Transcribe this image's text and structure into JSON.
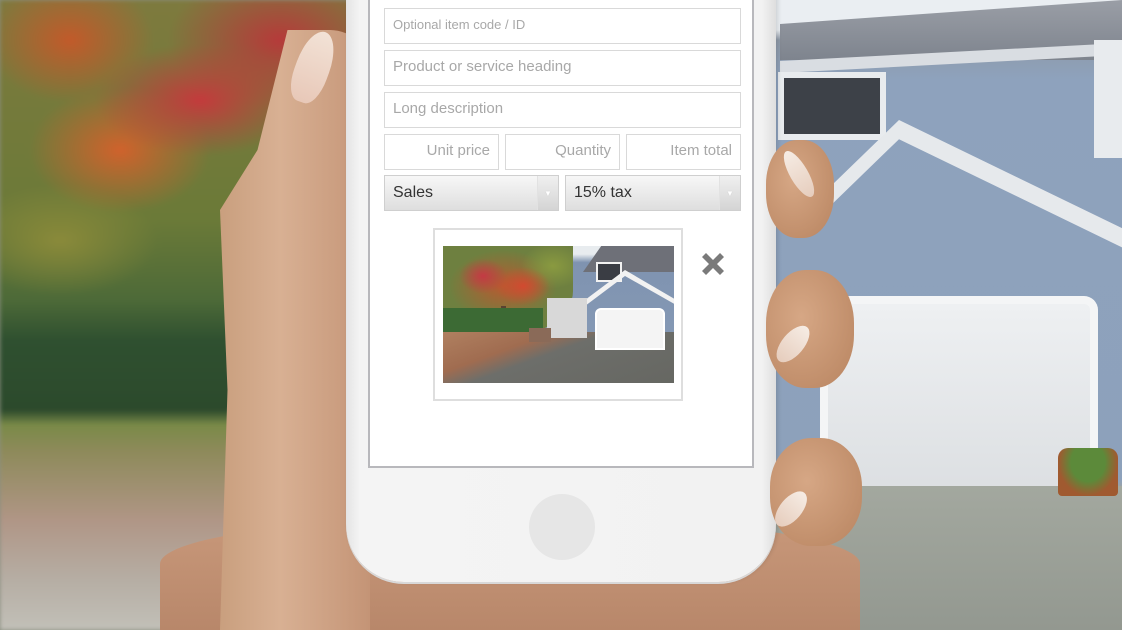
{
  "form": {
    "item_code": {
      "value": "",
      "placeholder": "Optional item code / ID"
    },
    "heading": {
      "value": "",
      "placeholder": "Product or service heading"
    },
    "description": {
      "value": "",
      "placeholder": "Long description"
    },
    "unit_price": {
      "value": "",
      "placeholder": "Unit price"
    },
    "quantity": {
      "value": "",
      "placeholder": "Quantity"
    },
    "item_total": {
      "value": "",
      "placeholder": "Item total"
    },
    "account_select": {
      "selected": "Sales"
    },
    "tax_select": {
      "selected": "15% tax"
    }
  },
  "attachment": {
    "image_alt": "House with autumn tree and driveway",
    "remove_icon": "close-x-icon"
  },
  "device": {
    "home_button_icon": "home-button"
  },
  "colors": {
    "placeholder_text": "#a8a8a8",
    "field_border": "#d9d9d9",
    "select_text": "#333333",
    "remove_icon": "#7a7a7a"
  }
}
